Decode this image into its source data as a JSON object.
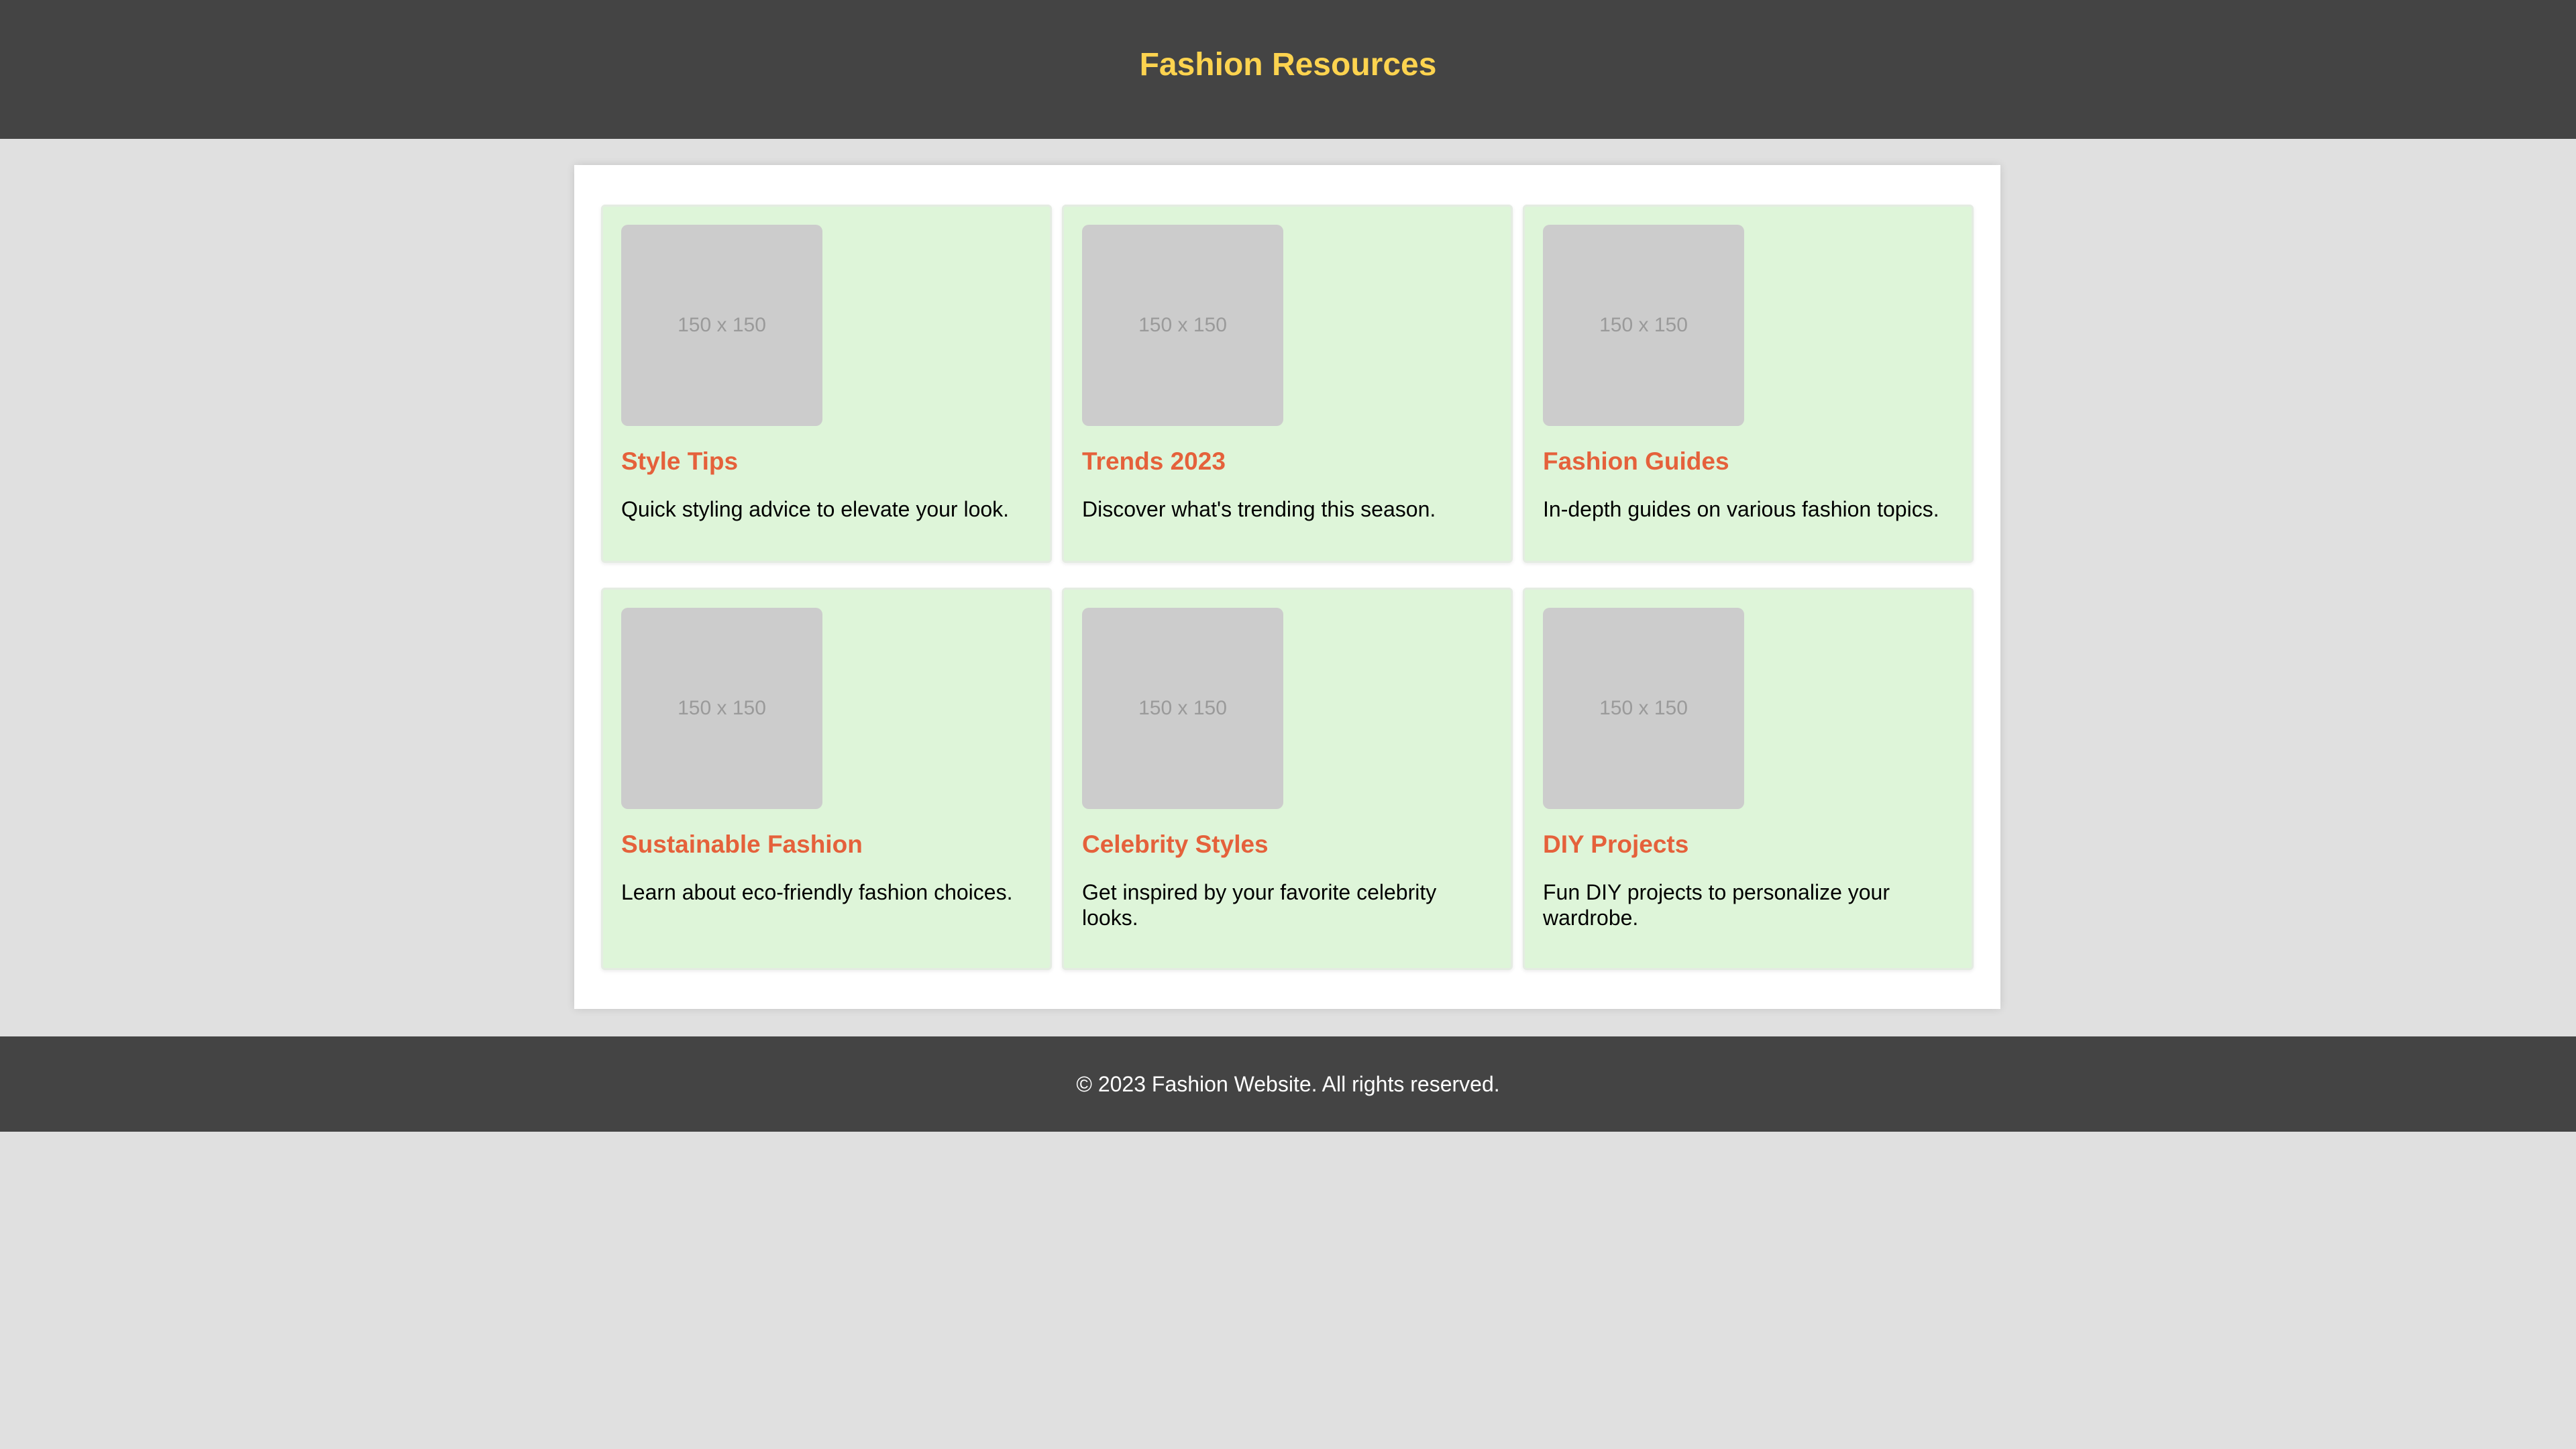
{
  "header": {
    "title": "Fashion Resources"
  },
  "cards": [
    {
      "image_text": "150 x 150",
      "title": "Style Tips",
      "description": "Quick styling advice to elevate your look."
    },
    {
      "image_text": "150 x 150",
      "title": "Trends 2023",
      "description": "Discover what's trending this season."
    },
    {
      "image_text": "150 x 150",
      "title": "Fashion Guides",
      "description": "In-depth guides on various fashion topics."
    },
    {
      "image_text": "150 x 150",
      "title": "Sustainable Fashion",
      "description": "Learn about eco-friendly fashion choices."
    },
    {
      "image_text": "150 x 150",
      "title": "Celebrity Styles",
      "description": "Get inspired by your favorite celebrity looks."
    },
    {
      "image_text": "150 x 150",
      "title": "DIY Projects",
      "description": "Fun DIY projects to personalize your wardrobe."
    }
  ],
  "footer": {
    "text": "© 2023 Fashion Website. All rights reserved."
  },
  "colors": {
    "header_bg": "#444444",
    "title_accent": "#fdd34f",
    "card_bg": "#def5d9",
    "card_title": "#e5613b",
    "page_bg": "#e0e0e0"
  }
}
